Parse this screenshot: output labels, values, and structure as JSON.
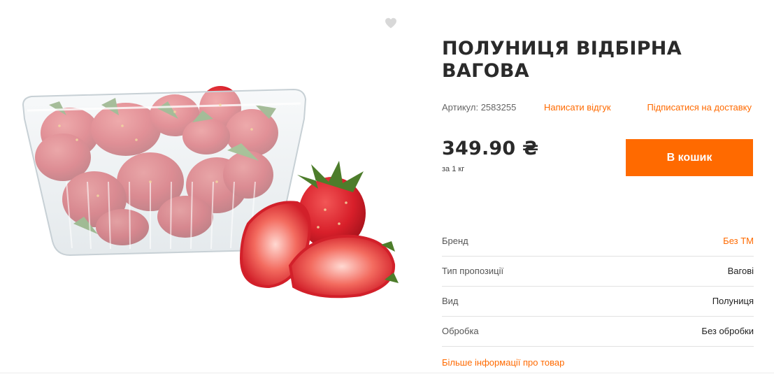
{
  "product": {
    "title": "ПОЛУНИЦЯ ВІДБІРНА ВАГОВА",
    "sku_label": "Артикул: 2583255",
    "review_link": "Написати відгук",
    "subscribe_link": "Підписатися на доставку",
    "price": "349.90 ₴",
    "unit": "за 1 кг",
    "cart_button": "В кошик",
    "more_info_link": "Більше інформації про товар",
    "image_icon": "strawberries-in-container-image",
    "wishlist_icon": "heart-icon"
  },
  "specs": [
    {
      "label": "Бренд",
      "value": "Без ТМ"
    },
    {
      "label": "Тип пропозиції",
      "value": "Вагові"
    },
    {
      "label": "Вид",
      "value": "Полуниця"
    },
    {
      "label": "Обробка",
      "value": "Без обробки"
    }
  ],
  "colors": {
    "accent": "#ff6a00",
    "text": "#2a2a2a",
    "muted": "#666666",
    "divider": "#e2e2e2"
  }
}
